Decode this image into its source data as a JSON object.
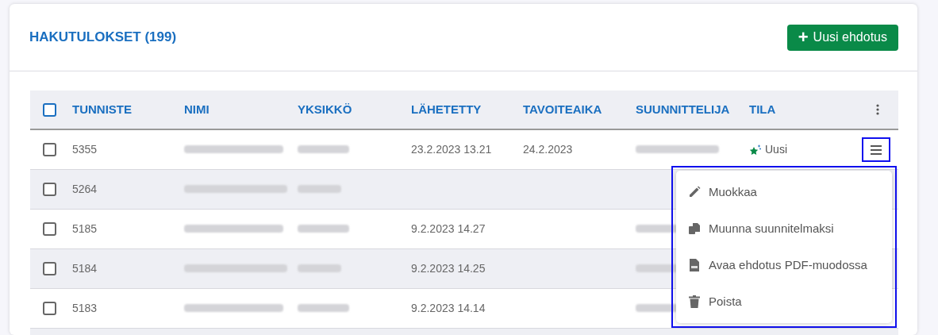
{
  "title": "HAKUTULOKSET (199)",
  "new_button": {
    "icon": "+",
    "label": "Uusi ehdotus"
  },
  "table": {
    "select_all": {
      "checked": false
    },
    "columns": [
      "TUNNISTE",
      "NIMI",
      "YKSIKKÖ",
      "LÄHETETTY",
      "TAVOITEAIKA",
      "SUUNNITTELIJA",
      "TILA"
    ],
    "rows": [
      {
        "checked": false,
        "id": "5355",
        "name_redacted": true,
        "unit_redacted": true,
        "sent": "23.2.2023 13.21",
        "target": "24.2.2023",
        "designer_redacted": true,
        "status": {
          "kind": "new",
          "label": "Uusi"
        },
        "menu_open": true
      },
      {
        "checked": false,
        "id": "5264",
        "name_redacted": true,
        "unit_redacted": true,
        "designer_redacted": false,
        "menu_open": false
      },
      {
        "checked": false,
        "id": "5185",
        "name_redacted": true,
        "unit_redacted": true,
        "sent": "9.2.2023 14.27",
        "designer_redacted": true,
        "menu_open": false
      },
      {
        "checked": false,
        "id": "5184",
        "name_redacted": true,
        "unit_redacted": true,
        "sent": "9.2.2023 14.25",
        "designer_redacted": true,
        "menu_open": false
      },
      {
        "checked": false,
        "id": "5183",
        "name_redacted": true,
        "unit_redacted": true,
        "sent": "9.2.2023 14.14",
        "designer_redacted": true,
        "menu_open": false
      }
    ]
  },
  "row_menu": [
    {
      "kind": "edit",
      "label": "Muokkaa"
    },
    {
      "kind": "convert",
      "label": "Muunna suunnitelmaksi"
    },
    {
      "kind": "pdf",
      "label": "Avaa ehdotus PDF-muodossa"
    },
    {
      "kind": "delete",
      "label": "Poista"
    }
  ]
}
